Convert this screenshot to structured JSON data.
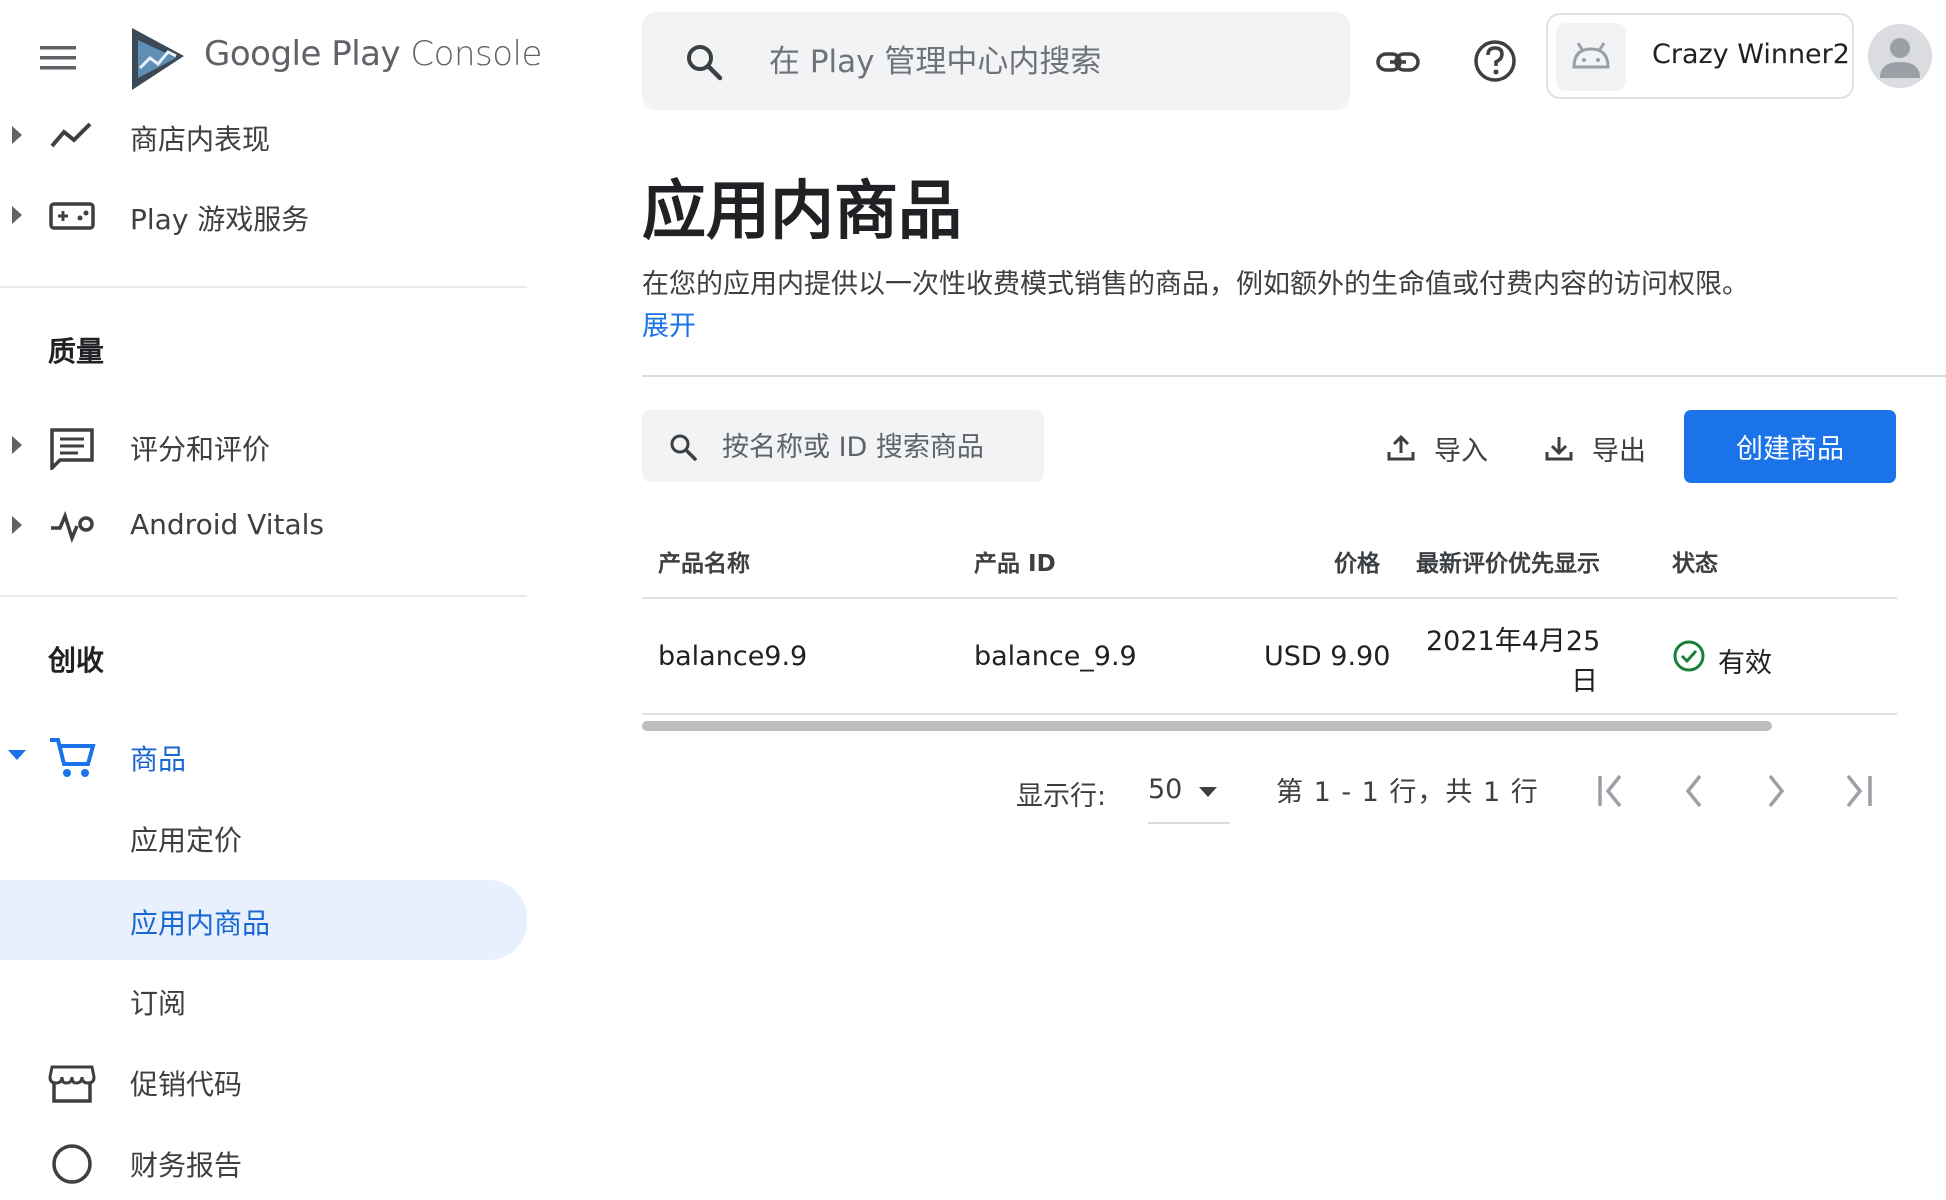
{
  "header": {
    "brand_google": "Google Play",
    "brand_console": "Console",
    "search_placeholder": "在 Play 管理中心内搜索",
    "app_name": "Crazy Winner2"
  },
  "sidebar": {
    "items_top": [
      {
        "label": "商店内表现",
        "icon": "trending-icon"
      },
      {
        "label": "Play 游戏服务",
        "icon": "gamepad-icon"
      }
    ],
    "section_quality": "质量",
    "items_quality": [
      {
        "label": "评分和评价",
        "icon": "review-icon"
      },
      {
        "label": "Android Vitals",
        "icon": "vitals-icon"
      }
    ],
    "section_monetize": "创收",
    "products": "商品",
    "app_pricing": "应用定价",
    "in_app_products": "应用内商品",
    "subscriptions": "订阅",
    "promo_codes": "促销代码",
    "financial_reports": "财务报告"
  },
  "main": {
    "title": "应用内商品",
    "description": "在您的应用内提供以一次性收费模式销售的商品，例如额外的生命值或付费内容的访问权限。",
    "expand": "展开",
    "search_placeholder": "按名称或 ID 搜索商品",
    "import": "导入",
    "export": "导出",
    "create": "创建商品"
  },
  "table": {
    "columns": [
      "产品名称",
      "产品 ID",
      "价格",
      "最新评价优先显示",
      "状态"
    ],
    "rows": [
      {
        "name": "balance9.9",
        "id": "balance_9.9",
        "price": "USD 9.90",
        "date_line1": "2021年4月25",
        "date_line2": "日",
        "status": "有效"
      }
    ]
  },
  "pagination": {
    "rows_label": "显示行:",
    "rows_value": "50",
    "range": "第 1 - 1 行，共 1 行"
  },
  "colors": {
    "accent": "#1a73e8",
    "active_bg": "#e8f0fe",
    "success": "#188038"
  }
}
